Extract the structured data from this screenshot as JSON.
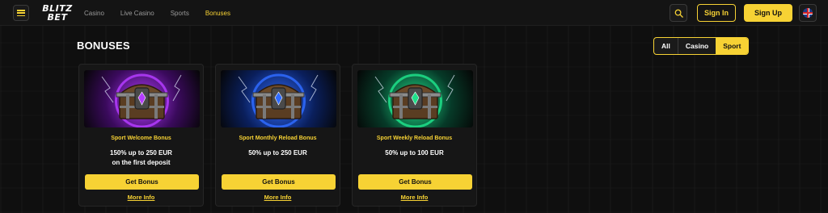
{
  "header": {
    "logo": {
      "line1": "BLITZ",
      "line2": "BET"
    },
    "nav": [
      "Casino",
      "Live Casino",
      "Sports",
      "Bonuses"
    ],
    "active_nav": "Bonuses",
    "signin_label": "Sign In",
    "signup_label": "Sign Up",
    "icons": {
      "menu": "hamburger-menu-icon",
      "search": "search-icon",
      "language": "uk-flag-icon"
    }
  },
  "page": {
    "title": "BONUSES",
    "filters": [
      "All",
      "Casino",
      "Sport"
    ],
    "active_filter": "Sport"
  },
  "cards": [
    {
      "title": "Sport Welcome Bonus",
      "desc_line1": "150% up to 250 EUR",
      "desc_line2": "on the first deposit",
      "button": "Get Bonus",
      "more": "More Info",
      "theme": {
        "glow": "#b43cff",
        "bg": "#3a0a5c"
      }
    },
    {
      "title": "Sport Monthly Reload Bonus",
      "desc_line1": "50% up to 250 EUR",
      "desc_line2": "",
      "button": "Get Bonus",
      "more": "More Info",
      "theme": {
        "glow": "#2f6bff",
        "bg": "#0a1f5c"
      }
    },
    {
      "title": "Sport Weekly Reload Bonus",
      "desc_line1": "50% up to 100 EUR",
      "desc_line2": "",
      "button": "Get Bonus",
      "more": "More Info",
      "theme": {
        "glow": "#1fe08a",
        "bg": "#063a28"
      }
    }
  ],
  "colors": {
    "accent": "#f7d234",
    "background": "#0d0d0d",
    "card": "#161616"
  }
}
